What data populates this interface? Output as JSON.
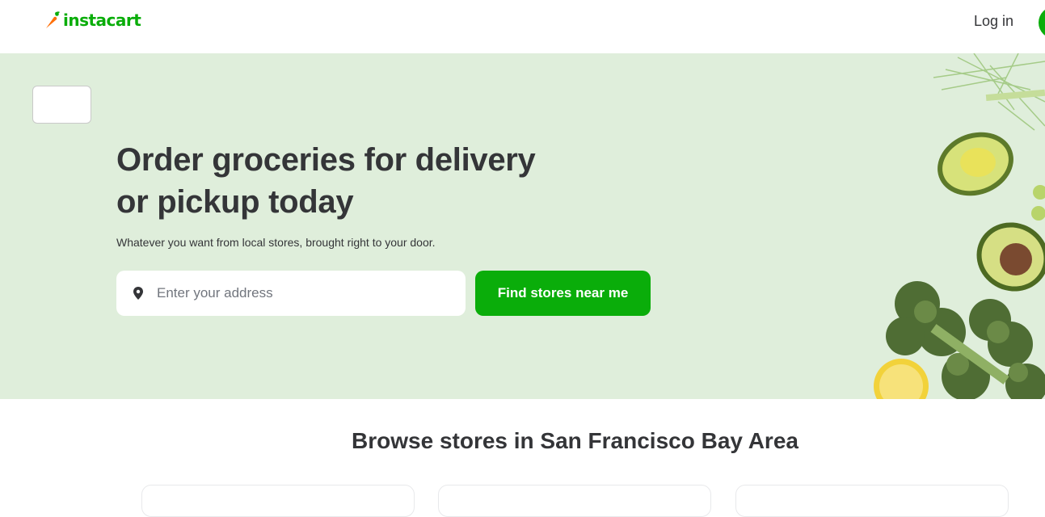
{
  "header": {
    "logo_text": "instacart",
    "login_label": "Log in"
  },
  "hero": {
    "headline_line1": "Order groceries for delivery",
    "headline_line2": "or pickup today",
    "subheadline": "Whatever you want from local stores, brought right to your door.",
    "address_placeholder": "Enter your address",
    "find_button_label": "Find stores near me"
  },
  "browse": {
    "title": "Browse stores in San Francisco Bay Area"
  },
  "colors": {
    "brand_green": "#0aad0a",
    "hero_bg": "#dfeedb",
    "logo_orange": "#ff7009",
    "text": "#343538"
  },
  "icons": [
    "carrot-logo-icon",
    "location-pin-icon"
  ]
}
